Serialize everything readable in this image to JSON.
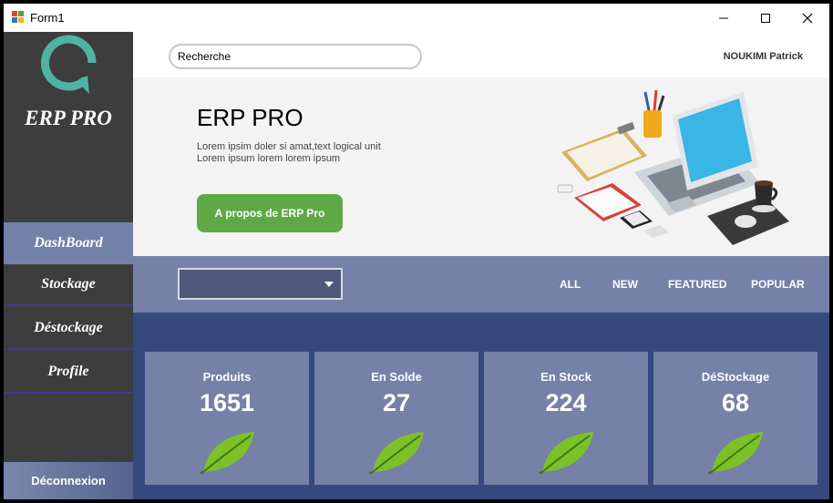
{
  "window": {
    "title": "Form1"
  },
  "sidebar": {
    "brand": "ERP PRO",
    "items": [
      {
        "label": "DashBoard",
        "active": true
      },
      {
        "label": "Stockage",
        "active": false
      },
      {
        "label": "Déstockage",
        "active": false
      },
      {
        "label": "Profile",
        "active": false
      }
    ],
    "logout_label": "Déconnexion"
  },
  "header": {
    "search_value": "Recherche",
    "user_name": "NOUKIMI Patrick"
  },
  "hero": {
    "title": "ERP PRO",
    "description_line1": "Lorem ipsim doler si amat,text logical unit",
    "description_line2": "Lorem ipsum lorem lorem ipsum",
    "button_label": "A propos de ERP Pro"
  },
  "filters": {
    "dropdown_value": "",
    "tabs": [
      "ALL",
      "NEW",
      "FEATURED",
      "POPULAR"
    ]
  },
  "stats": [
    {
      "label": "Produits",
      "value": "1651"
    },
    {
      "label": "En Solde",
      "value": "27"
    },
    {
      "label": "En Stock",
      "value": "224"
    },
    {
      "label": "DéStockage",
      "value": "68"
    }
  ],
  "colors": {
    "sidebar": "#3d3d3d",
    "accent_nav": "#7281a7",
    "button_green": "#5ea945",
    "stats_bg": "#36497f",
    "card_bg": "#7581a7",
    "logo_teal": "#4fb3a2"
  }
}
